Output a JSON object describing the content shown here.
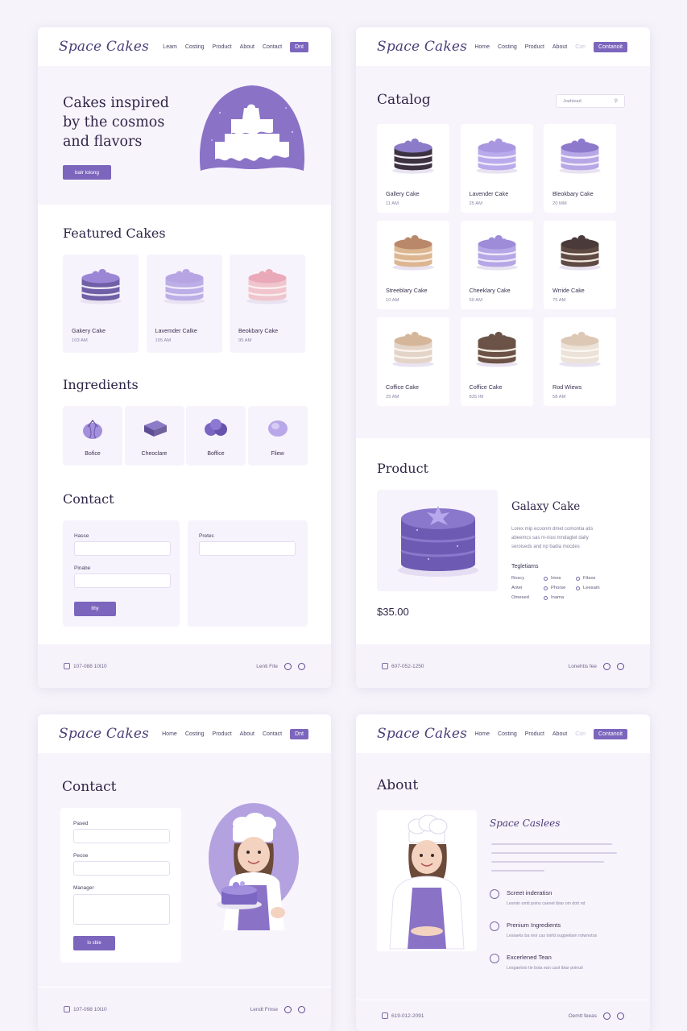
{
  "brand": "Space Cakes",
  "nav": {
    "p1": [
      "Leam",
      "Costing",
      "Product",
      "About",
      "Contact",
      "Dnt"
    ],
    "p2": [
      "Home",
      "Costing",
      "Product",
      "About",
      "Con",
      "Contanoit"
    ],
    "p3": [
      "Home",
      "Costing",
      "Product",
      "About",
      "Contact",
      "Dnt"
    ],
    "p4": [
      "Home",
      "Costing",
      "Product",
      "About",
      "Con",
      "Contanoit"
    ]
  },
  "home": {
    "hero_title": [
      "Cakes inspired",
      "by the cosmos",
      "and flavors"
    ],
    "hero_button": "balr loiong",
    "featured_title": "Featured Cakes",
    "featured": [
      {
        "name": "Gakery Cake",
        "time": "103 AM",
        "frost": "#9b86d6",
        "body": "#6f5fa6",
        "layer": "#ede6f7"
      },
      {
        "name": "Lavemder Calke",
        "time": "105 AM",
        "frost": "#b7a4e3",
        "body": "#bcaee6",
        "layer": "#efe9f9"
      },
      {
        "name": "Beokbary Cake",
        "time": "95 AM",
        "frost": "#e9a9b8",
        "body": "#f0c5cd",
        "layer": "#fbeef0"
      }
    ],
    "ingredients_title": "Ingredients",
    "ingredients": [
      {
        "name": "Bofice",
        "icon": "berry-icon"
      },
      {
        "name": "Cheoclare",
        "icon": "chocolate-icon"
      },
      {
        "name": "Boffice",
        "icon": "blueberry-icon"
      },
      {
        "name": "Fliew",
        "icon": "flower-icon"
      }
    ],
    "contact_title": "Contact",
    "form": {
      "label1": "Hasse",
      "label2": "Pinabe",
      "label3": "Pretec",
      "button": "lthy"
    },
    "footer_phone": "107-088 10l10",
    "footer_link": "Lenti Fite"
  },
  "catalog": {
    "title": "Catalog",
    "search_placeholder": "Joahtoad",
    "items": [
      {
        "name": "Gallery Cake",
        "time": "11 AM",
        "frost": "#8c7bc8",
        "body": "#3d3240",
        "layer": "#f2eef7"
      },
      {
        "name": "Lavender Cake",
        "time": "25 AM",
        "frost": "#a996e0",
        "body": "#b9aaeb",
        "layer": "#f0ebfa"
      },
      {
        "name": "Bleokbary Cake",
        "time": "20 MM",
        "frost": "#8d79cc",
        "body": "#b8a7e6",
        "layer": "#f2edfb"
      },
      {
        "name": "Streeblary Cake",
        "time": "10 AM",
        "frost": "#b9876a",
        "body": "#dcb691",
        "layer": "#f7ecdf"
      },
      {
        "name": "Cheeklary Cake",
        "time": "50 AM",
        "frost": "#9e8cd8",
        "body": "#b5a6e6",
        "layer": "#efe9f9"
      },
      {
        "name": "Wrride Cake",
        "time": "75 AM",
        "frost": "#4a3a3a",
        "body": "#5e4a42",
        "layer": "#efe5dc"
      },
      {
        "name": "Coffice Cake",
        "time": "25 AM",
        "frost": "#d6b69a",
        "body": "#e4d4c8",
        "layer": "#faf4ee"
      },
      {
        "name": "Coffice Cake",
        "time": "835 IM",
        "frost": "#6b5348",
        "body": "#6c5246",
        "layer": "#f3ebe3"
      },
      {
        "name": "Rod Wiews",
        "time": "58 AM",
        "frost": "#dcc8b5",
        "body": "#ece2d7",
        "layer": "#fbf7f2"
      }
    ],
    "product_title": "Product",
    "product_name": "Galaxy Cake",
    "product_desc": [
      "Lorex mip ecoonm dmet comontia atis",
      "abeemcs sas m-nius mndagtet daily",
      "seroiseds and np badia mocdes"
    ],
    "product_sub": "Tegletiams",
    "options": [
      [
        "Roscy",
        "Imes",
        "Fitsos"
      ],
      [
        "Antei",
        "Phorse",
        "Leesam"
      ],
      [
        "Omesed",
        "Inama",
        ""
      ]
    ],
    "price": "$35.00",
    "footer_phone": "607-052-1250",
    "footer_link": "Lonehtis fee"
  },
  "contact": {
    "title": "Contact",
    "labels": [
      "Pased",
      "Peose",
      "Manager"
    ],
    "button": "lo sbie",
    "footer_phone": "107-098 10l10",
    "footer_link": "Lendt Fmse"
  },
  "about": {
    "title": "About",
    "brand_script": "Space Caslees",
    "features": [
      {
        "title": "Screet inderatisn",
        "text": "Lesmin omti poins caeset ibiar oin dott nd"
      },
      {
        "title": "Prenium Ingredients",
        "text": "Lesiaeks ba moi cas toirld sugpieilam rotwnotos"
      },
      {
        "title": "Excerlened Tean",
        "text": "Lesgaeloio tie bota ean caot ibiar poinuit"
      }
    ],
    "footer_phone": "619-012-2091",
    "footer_link": "Oemtt feeas"
  }
}
